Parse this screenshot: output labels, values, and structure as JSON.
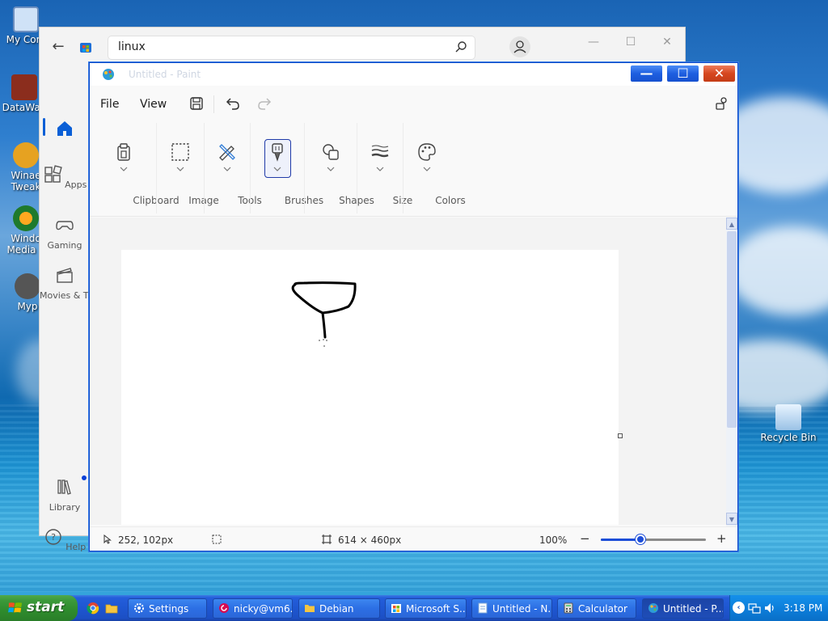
{
  "desktop": {
    "icons": [
      {
        "label": "My Com"
      },
      {
        "label": "DataWag"
      },
      {
        "label": "Winae Tweak"
      },
      {
        "label": "Windo Media P"
      },
      {
        "label": "Myp"
      },
      {
        "label": "Recycle Bin"
      }
    ]
  },
  "store": {
    "search_value": "linux",
    "nav": [
      {
        "label": "Apps",
        "icon": "apps-icon"
      },
      {
        "label": "Gaming",
        "icon": "gaming-icon"
      },
      {
        "label": "Movies & TV",
        "icon": "movies-icon"
      },
      {
        "label": "Library",
        "icon": "library-icon"
      },
      {
        "label": "Help",
        "icon": "help-icon"
      }
    ]
  },
  "paint": {
    "title": "Untitled - Paint",
    "menu": {
      "file": "File",
      "view": "View"
    },
    "ribbon": [
      {
        "label": "Clipboard",
        "icon": "clipboard-icon"
      },
      {
        "label": "Image",
        "icon": "selection-icon"
      },
      {
        "label": "Tools",
        "icon": "tools-icon"
      },
      {
        "label": "Brushes",
        "icon": "brush-icon"
      },
      {
        "label": "Shapes",
        "icon": "shapes-icon"
      },
      {
        "label": "Size",
        "icon": "size-icon"
      },
      {
        "label": "Colors",
        "icon": "palette-icon"
      }
    ],
    "status": {
      "cursor_pos": "252, 102px",
      "canvas_size": "614 × 460px",
      "zoom": "100%",
      "zoom_fraction": 0.38
    }
  },
  "taskbar": {
    "start_label": "start",
    "tasks": [
      {
        "label": "Settings"
      },
      {
        "label": "nicky@vm6..."
      },
      {
        "label": "Debian"
      },
      {
        "label": "Microsoft S..."
      },
      {
        "label": "Untitled - N..."
      },
      {
        "label": "Calculator"
      },
      {
        "label": "Untitled - P..."
      }
    ],
    "clock": "3:18 PM"
  },
  "colors": {
    "xp_blue": "#245edb",
    "start_green": "#3c9a3a",
    "store_accent": "#0a5fd6",
    "paint_accent": "#1d4ed8"
  }
}
